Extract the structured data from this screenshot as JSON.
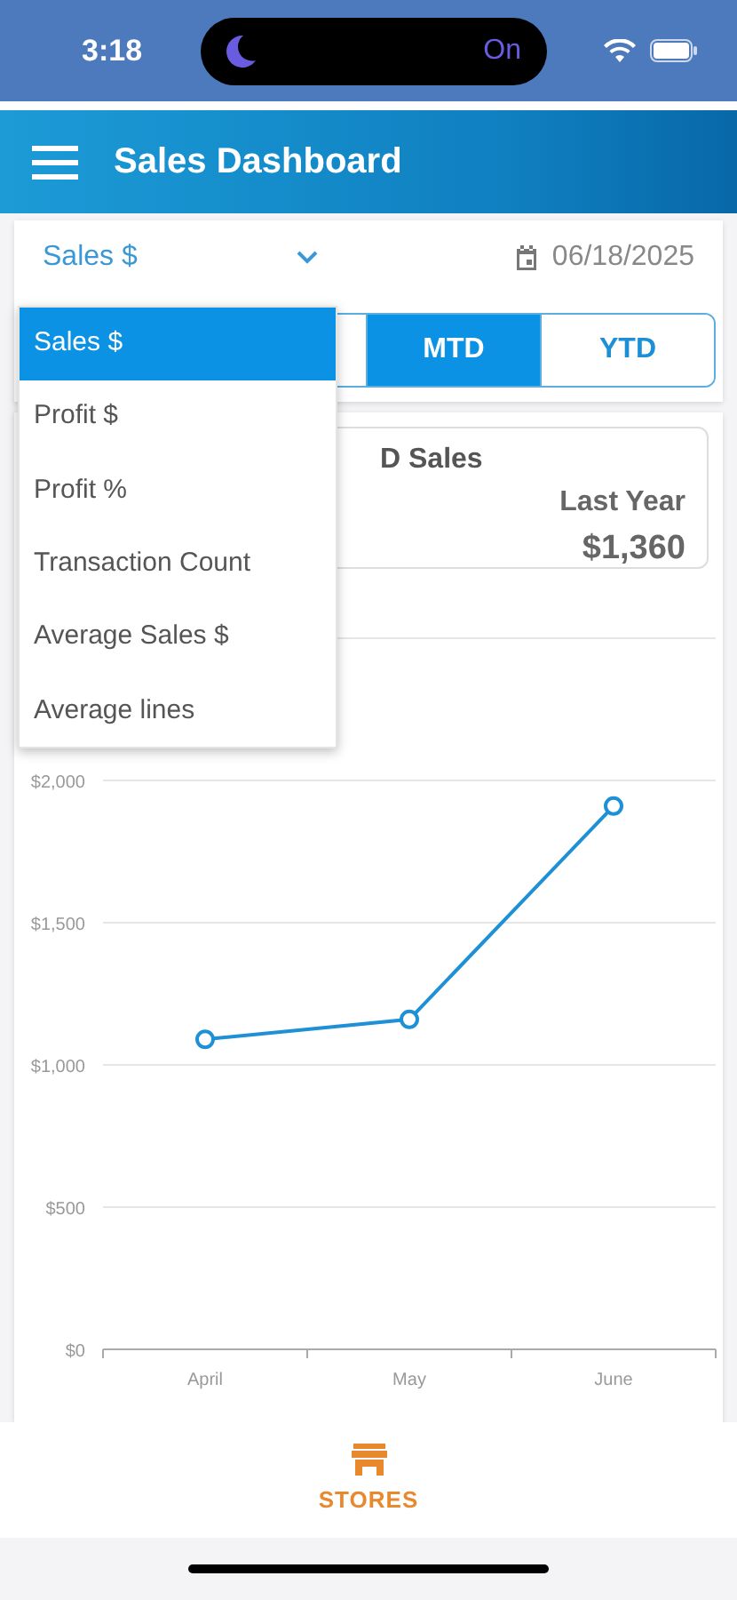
{
  "status_bar": {
    "time": "3:18",
    "focus_label": "On"
  },
  "header": {
    "title": "Sales Dashboard"
  },
  "filters": {
    "metric": "Sales $",
    "date": "06/18/2025",
    "periods": [
      {
        "label": "MTD",
        "selected": true
      },
      {
        "label": "YTD",
        "selected": false
      }
    ]
  },
  "metric_menu": [
    {
      "label": "Sales $",
      "selected": true
    },
    {
      "label": "Profit $",
      "selected": false
    },
    {
      "label": "Profit %",
      "selected": false
    },
    {
      "label": "Transaction Count",
      "selected": false
    },
    {
      "label": "Average Sales $",
      "selected": false
    },
    {
      "label": "Average lines",
      "selected": false
    }
  ],
  "summary": {
    "title": "D Sales",
    "comparison_label": "Last Year",
    "comparison_value": "$1,360"
  },
  "chart": {
    "chart_data": {
      "type": "line",
      "grid": true,
      "categories": [
        "April",
        "May",
        "June"
      ],
      "ylim": [
        0,
        2500
      ],
      "yticks": [
        {
          "value": 0,
          "label": "$0"
        },
        {
          "value": 500,
          "label": "$500"
        },
        {
          "value": 1000,
          "label": "$1,000"
        },
        {
          "value": 1500,
          "label": "$1,500"
        },
        {
          "value": 2000,
          "label": "$2,000"
        }
      ],
      "series": [
        {
          "color": "#1e90d6",
          "marker": "circle",
          "values": [
            1090,
            1160,
            1910
          ]
        }
      ]
    }
  },
  "bottom_nav": [
    {
      "label": "STORES",
      "selected": true
    }
  ]
}
